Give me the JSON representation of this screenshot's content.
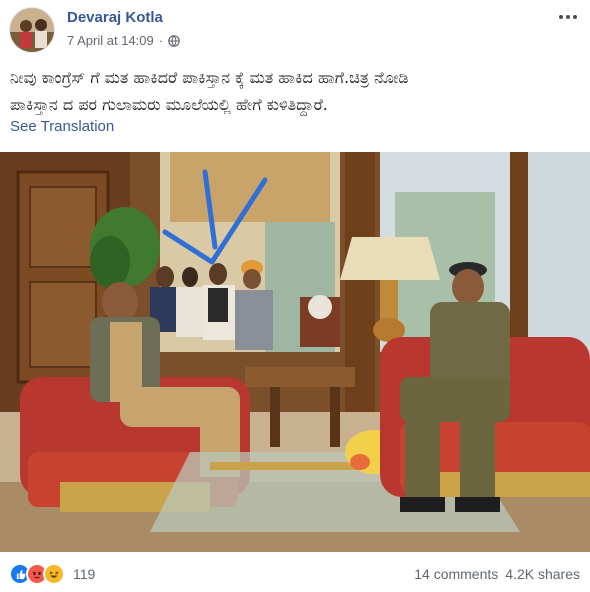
{
  "post": {
    "author": "Devaraj Kotla",
    "timestamp": "7 April at 14:09",
    "separator": "·",
    "privacy_icon": "globe-icon",
    "more_icon": "more-options-icon",
    "text_line1": "ನೀವು ಕಾಂಗ್ರೆಸ್ ಗೆ ಮತ ಹಾಕಿದರೆ ಪಾಕಿಸ್ತಾನ ಕ್ಕೆ ಮತ ಹಾಕಿದ ಹಾಗೆ.ಚಿತ್ರ ನೋಡಿ",
    "text_line2": "ಪಾಕಿಸ್ತಾನ ದ ಪರ ಗುಲಾಮರು ಮೂಲೆಯಲ್ಲಿ ಹೇಗೆ ಕುಳಿತಿದ್ದಾರೆ.",
    "see_translation": "See Translation"
  },
  "photo": {
    "description_icon": "shared-photo",
    "arrow_color": "#2f6fd6"
  },
  "footer": {
    "reactions": [
      "like-icon",
      "angry-icon",
      "haha-icon"
    ],
    "reaction_count": "119",
    "comments": "14 comments",
    "shares": "4.2K shares"
  },
  "colors": {
    "link": "#385898",
    "meta": "#616770",
    "like": "#1877f2",
    "angry": "#f0594b",
    "haha": "#f7b928"
  }
}
